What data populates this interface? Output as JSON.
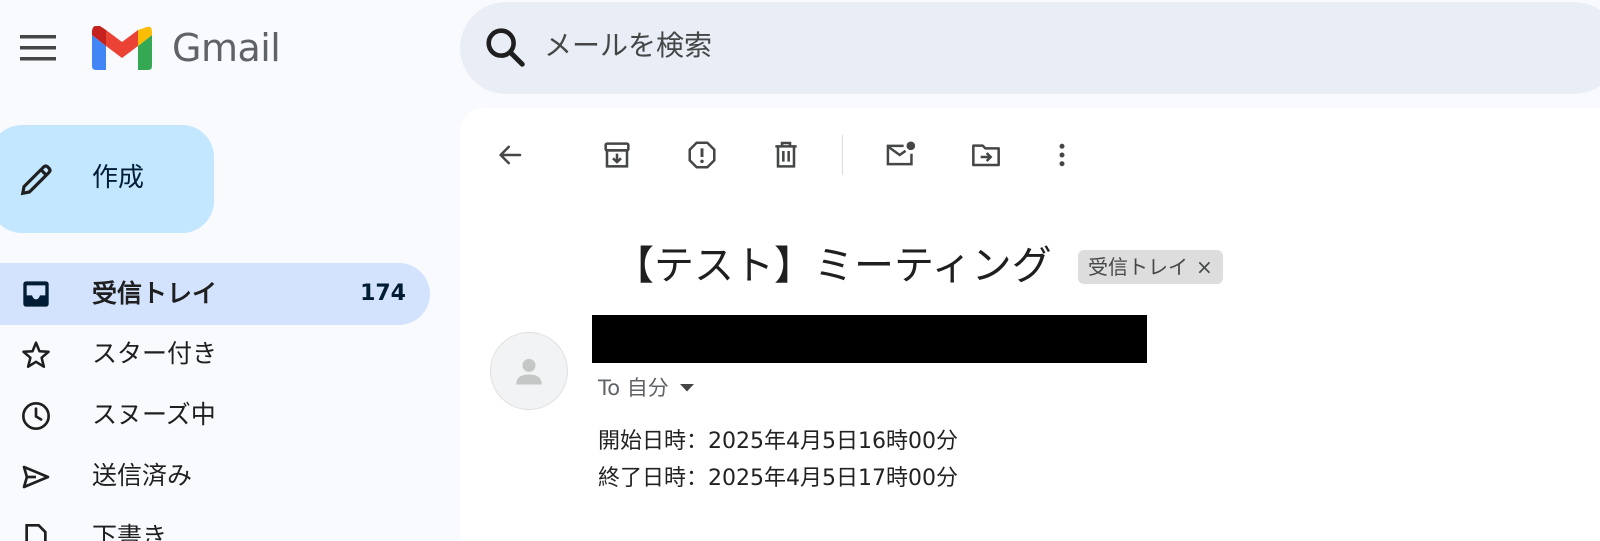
{
  "app": {
    "logo_text": "Gmail"
  },
  "search": {
    "placeholder": "メールを検索"
  },
  "compose": {
    "label": "作成"
  },
  "sidebar": {
    "items": [
      {
        "label": "受信トレイ",
        "count": "174",
        "icon": "inbox-icon",
        "active": true
      },
      {
        "label": "スター付き",
        "count": "",
        "icon": "star-icon",
        "active": false
      },
      {
        "label": "スヌーズ中",
        "count": "",
        "icon": "clock-icon",
        "active": false
      },
      {
        "label": "送信済み",
        "count": "",
        "icon": "send-icon",
        "active": false
      },
      {
        "label": "下書き",
        "count": "",
        "icon": "draft-icon",
        "active": false
      }
    ]
  },
  "toolbar": {
    "icons": [
      "back-arrow-icon",
      "archive-icon",
      "report-spam-icon",
      "delete-icon",
      "mark-unread-icon",
      "move-to-icon",
      "more-vert-icon"
    ]
  },
  "message": {
    "subject": "【テスト】ミーティング",
    "label_chip": "受信トレイ",
    "chip_close": "×",
    "to_line": "To 自分",
    "body_lines": [
      "開始日時：2025年4月5日16時00分",
      "終了日時：2025年4月5日17時00分"
    ]
  },
  "colors": {
    "background": "#f8fafd",
    "compose_bg": "#c2e7ff",
    "active_nav_bg": "#d3e3fd",
    "search_bg": "#e9eef6",
    "chip_bg": "#dddddd"
  }
}
